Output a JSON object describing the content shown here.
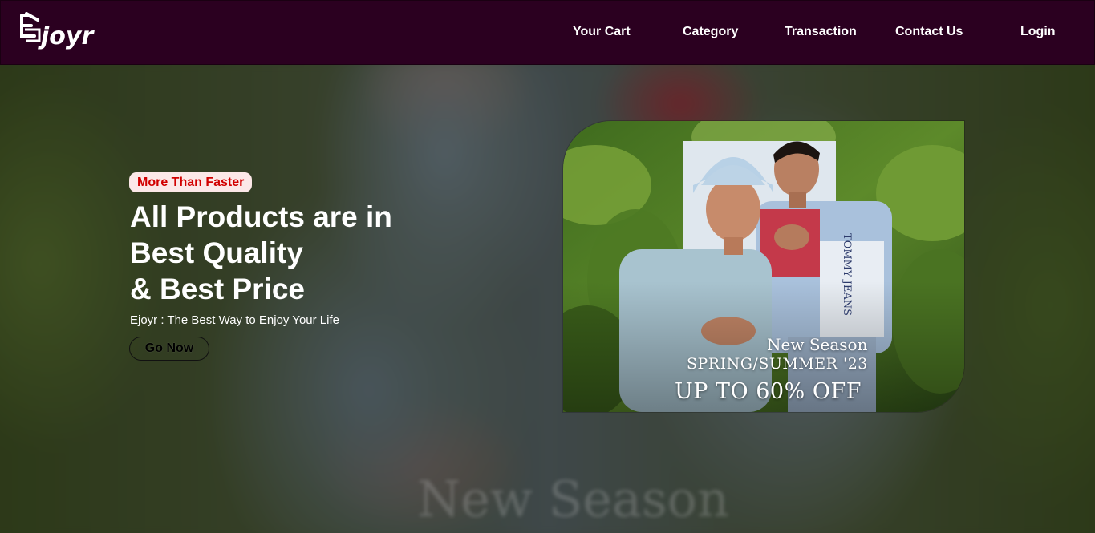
{
  "brand": {
    "logo_text": "Ejoyr"
  },
  "nav": {
    "items": [
      {
        "label": "Your Cart"
      },
      {
        "label": "Category"
      },
      {
        "label": "Transaction"
      },
      {
        "label": "Contact Us"
      },
      {
        "label": "Login"
      }
    ]
  },
  "hero": {
    "badge": "More Than Faster",
    "headline_line1": "All Products are in",
    "headline_line2": "Best Quality",
    "headline_line3": "& Best Price",
    "tagline": "Ejoyr : The Best Way to Enjoy Your Life",
    "cta_label": "Go Now",
    "background_watermark": "New Season"
  },
  "promo": {
    "line1": "New Season",
    "line2": "SPRING/SUMMER '23",
    "line3": "UP TO 60% OFF",
    "shirt_print": "TOMMY JEANS"
  },
  "colors": {
    "navbar": "#2b0020",
    "badge_bg": "#fce8e8",
    "badge_text": "#d10000",
    "text": "#ffffff"
  }
}
